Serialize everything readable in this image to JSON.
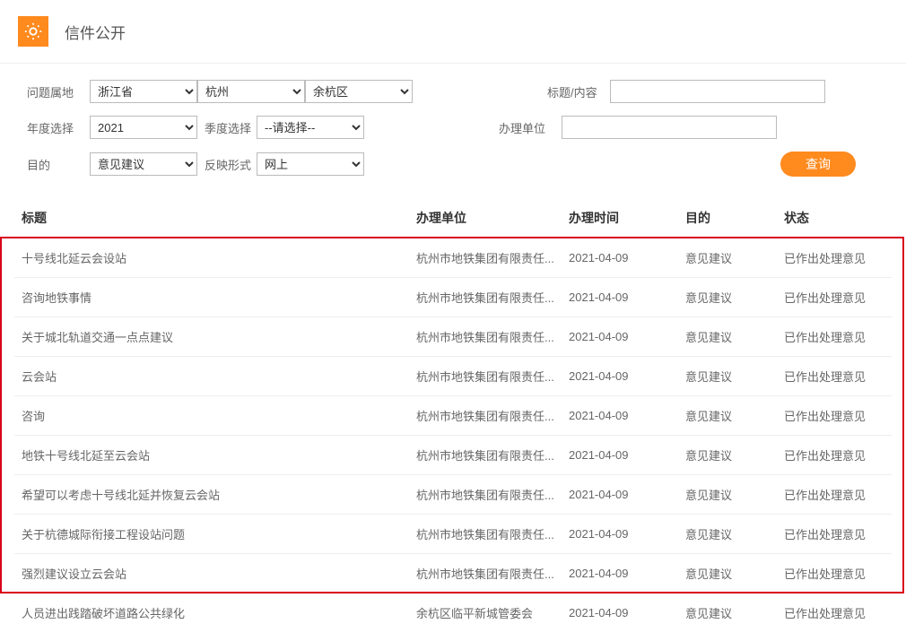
{
  "header": {
    "title": "信件公开"
  },
  "filters": {
    "region_label": "问题属地",
    "province": "浙江省",
    "city": "杭州",
    "district": "余杭区",
    "title_label": "标题/内容",
    "title_value": "",
    "year_label": "年度选择",
    "year": "2021",
    "quarter_label": "季度选择",
    "quarter": "--请选择--",
    "unit_label": "办理单位",
    "unit_value": "",
    "purpose_label": "目的",
    "purpose": "意见建议",
    "form_label": "反映形式",
    "form": "网上",
    "search_btn": "查询"
  },
  "table": {
    "headers": {
      "title": "标题",
      "unit": "办理单位",
      "time": "办理时间",
      "purpose": "目的",
      "status": "状态"
    },
    "rows": [
      {
        "title": "十号线北延云会设站",
        "unit": "杭州市地铁集团有限责任...",
        "time": "2021-04-09",
        "purpose": "意见建议",
        "status": "已作出处理意见"
      },
      {
        "title": "咨询地铁事情",
        "unit": "杭州市地铁集团有限责任...",
        "time": "2021-04-09",
        "purpose": "意见建议",
        "status": "已作出处理意见"
      },
      {
        "title": "关于城北轨道交通一点点建议",
        "unit": "杭州市地铁集团有限责任...",
        "time": "2021-04-09",
        "purpose": "意见建议",
        "status": "已作出处理意见"
      },
      {
        "title": "云会站",
        "unit": "杭州市地铁集团有限责任...",
        "time": "2021-04-09",
        "purpose": "意见建议",
        "status": "已作出处理意见"
      },
      {
        "title": "咨询",
        "unit": "杭州市地铁集团有限责任...",
        "time": "2021-04-09",
        "purpose": "意见建议",
        "status": "已作出处理意见"
      },
      {
        "title": "地铁十号线北延至云会站",
        "unit": "杭州市地铁集团有限责任...",
        "time": "2021-04-09",
        "purpose": "意见建议",
        "status": "已作出处理意见"
      },
      {
        "title": "希望可以考虑十号线北延并恢复云会站",
        "unit": "杭州市地铁集团有限责任...",
        "time": "2021-04-09",
        "purpose": "意见建议",
        "status": "已作出处理意见"
      },
      {
        "title": "关于杭德城际衔接工程设站问题",
        "unit": "杭州市地铁集团有限责任...",
        "time": "2021-04-09",
        "purpose": "意见建议",
        "status": "已作出处理意见"
      },
      {
        "title": "强烈建议设立云会站",
        "unit": "杭州市地铁集团有限责任...",
        "time": "2021-04-09",
        "purpose": "意见建议",
        "status": "已作出处理意见"
      },
      {
        "title": "人员进出践踏破坏道路公共绿化",
        "unit": "余杭区临平新城管委会",
        "time": "2021-04-09",
        "purpose": "意见建议",
        "status": "已作出处理意见"
      }
    ],
    "highlight": {
      "from_row": 0,
      "to_row": 8
    }
  }
}
